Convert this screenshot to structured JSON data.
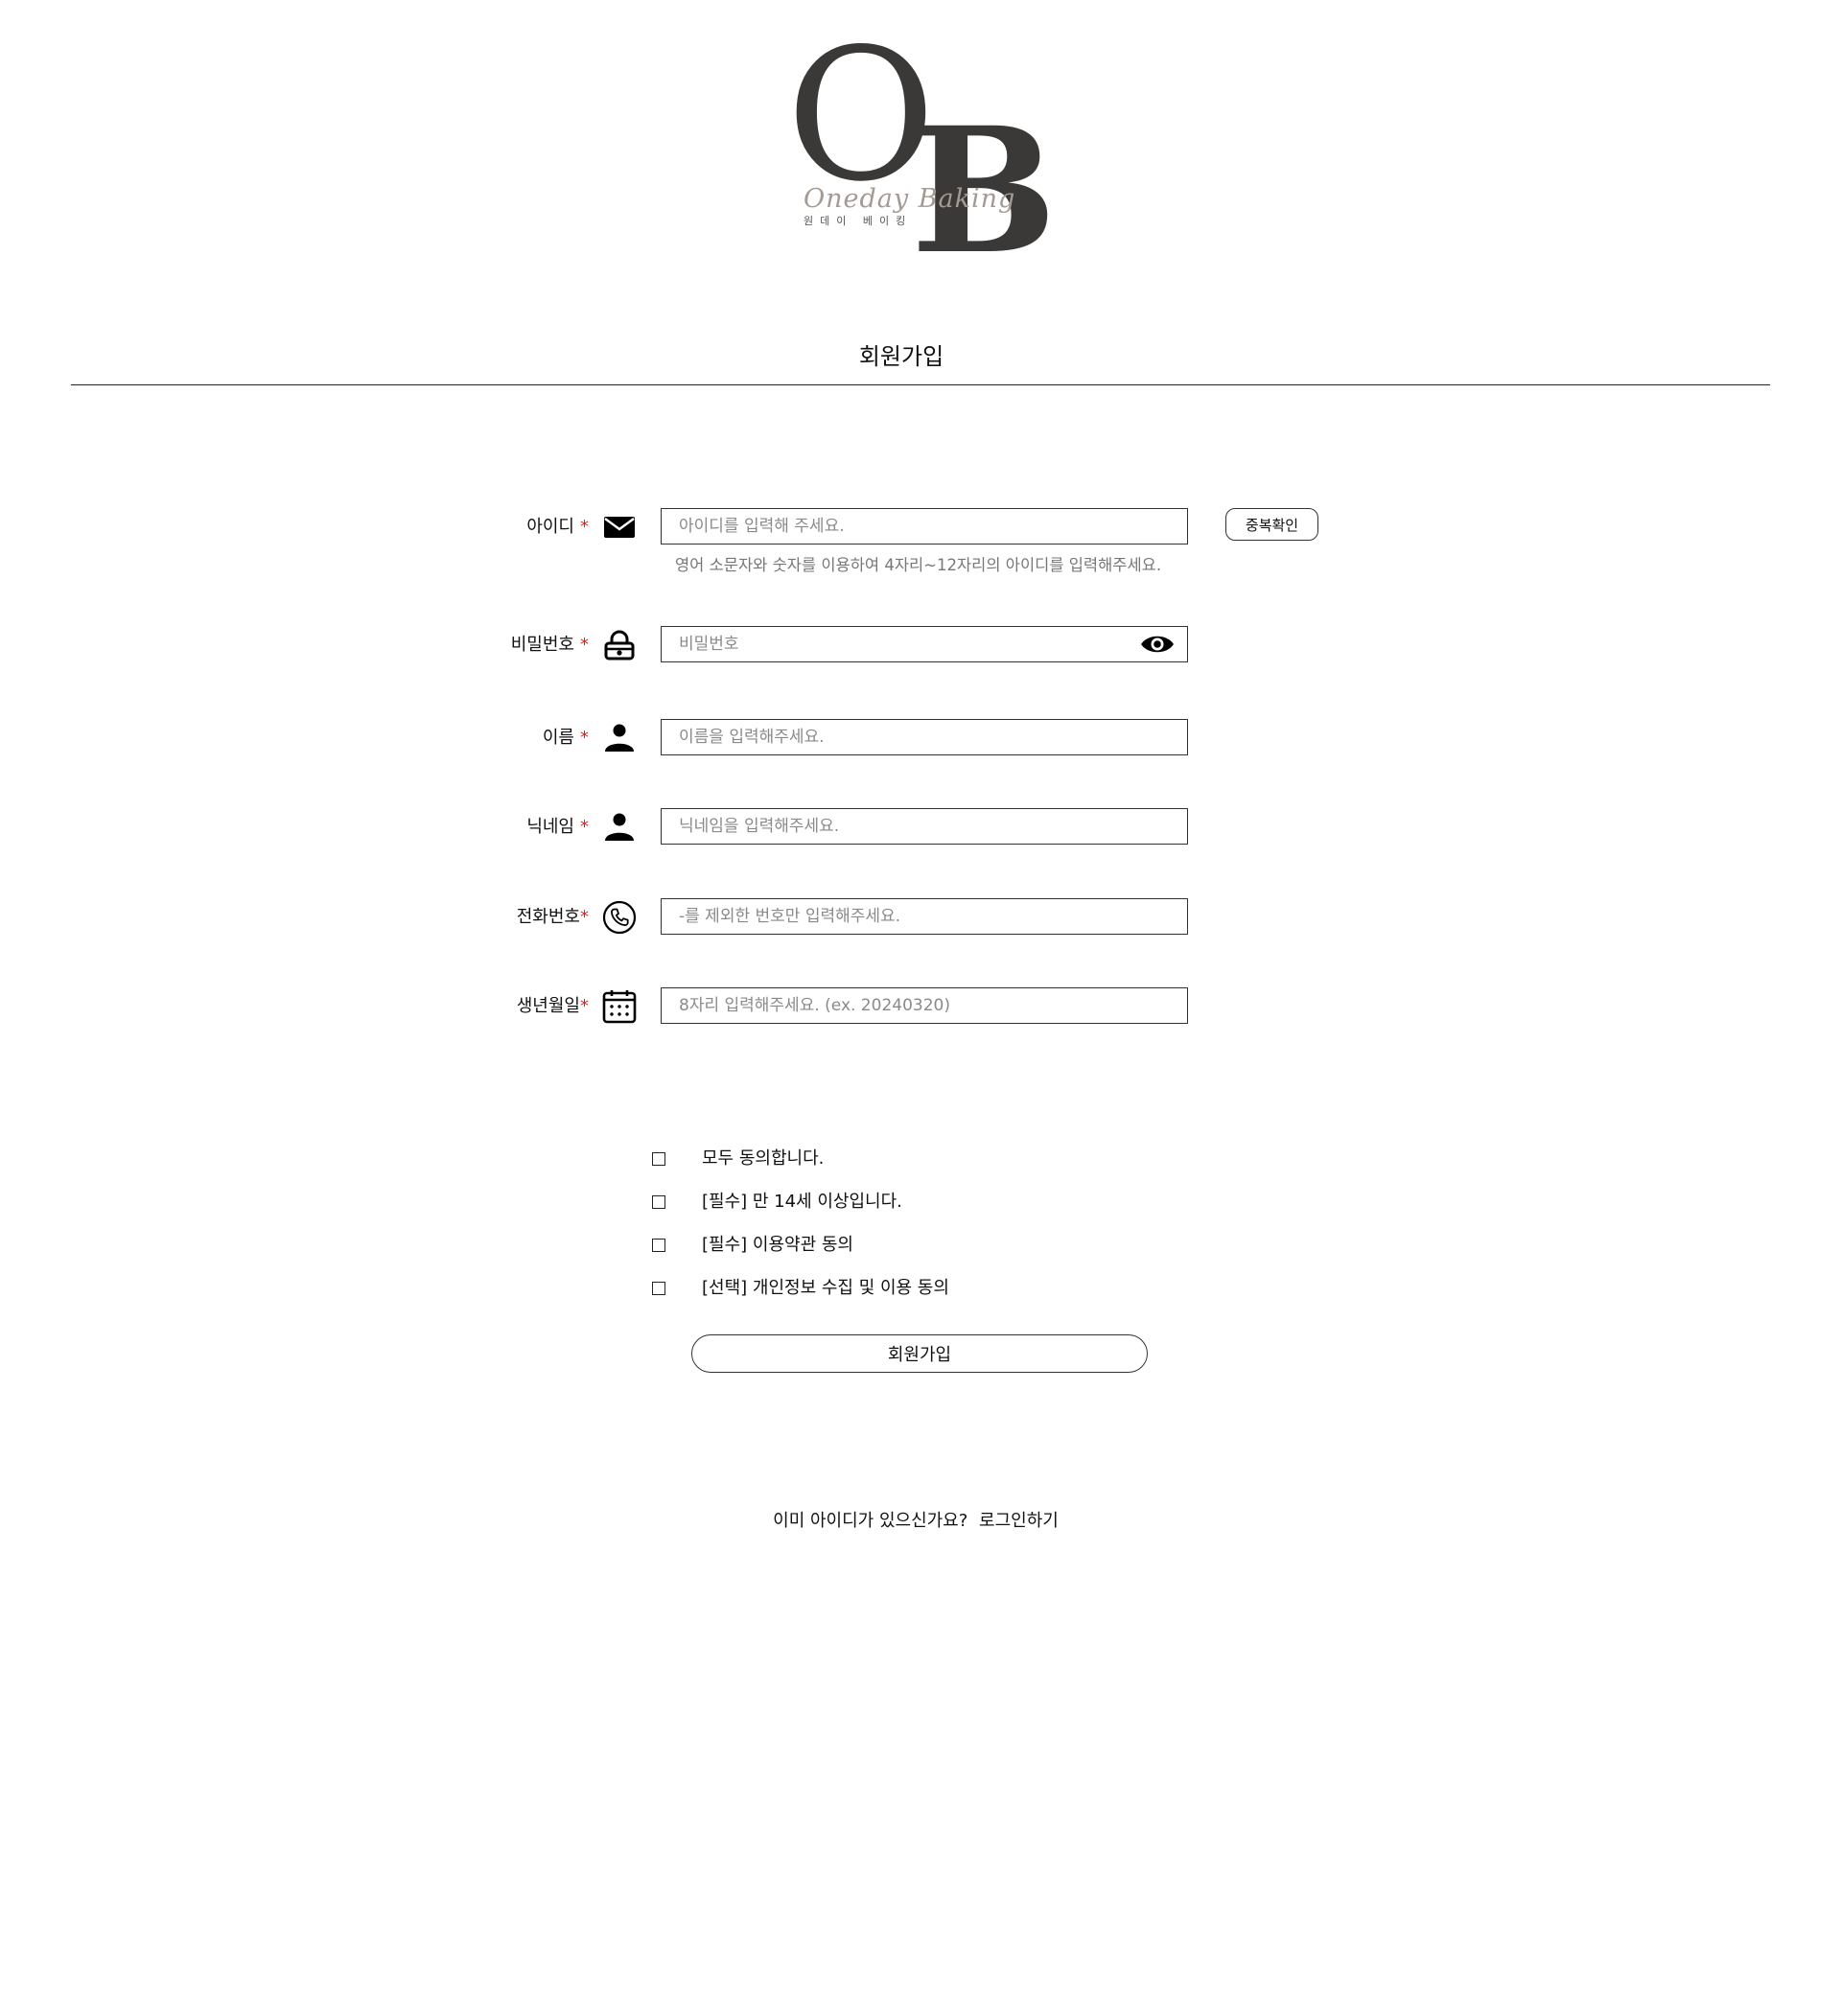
{
  "logo": {
    "letters": [
      "O",
      "B"
    ],
    "script_text": "Oneday Baking",
    "korean_text": "원데이 베이킹"
  },
  "page_title": "회원가입",
  "form": {
    "id": {
      "label": "아이디",
      "required_mark": "*",
      "icon": "envelope-icon",
      "placeholder": "아이디를 입력해 주세요.",
      "help": "영어 소문자와 숫자를 이용하여 4자리~12자리의 아이디를 입력해주세요.",
      "check_button": "중복확인"
    },
    "password": {
      "label": "비밀번호",
      "required_mark": "*",
      "icon": "lock-icon",
      "placeholder": "비밀번호",
      "toggle_icon": "eye-icon"
    },
    "name": {
      "label": "이름",
      "required_mark": "*",
      "icon": "person-icon",
      "placeholder": "이름을 입력해주세요."
    },
    "nickname": {
      "label": "닉네임",
      "required_mark": "*",
      "icon": "person-icon",
      "placeholder": "닉네임을 입력해주세요."
    },
    "phone": {
      "label": "전화번호",
      "required_mark": "*",
      "icon": "phone-icon",
      "placeholder": "-를 제외한 번호만 입력해주세요."
    },
    "birth": {
      "label": "생년월일",
      "required_mark": "*",
      "icon": "calendar-icon",
      "placeholder": "8자리 입력해주세요. (ex. 20240320)"
    }
  },
  "agreements": [
    {
      "label": "모두 동의합니다.",
      "checked": false
    },
    {
      "label": "[필수] 만 14세 이상입니다.",
      "checked": false
    },
    {
      "label": "[필수] 이용약관 동의",
      "checked": false
    },
    {
      "label": "[선택] 개인정보 수집 및 이용 동의",
      "checked": false
    }
  ],
  "submit_label": "회원가입",
  "footer": {
    "question": "이미 아이디가 있으신가요?",
    "login_link": "로그인하기"
  },
  "colors": {
    "required": "#e02020",
    "logo_dark": "#3a3937",
    "logo_script": "#a59a92"
  }
}
